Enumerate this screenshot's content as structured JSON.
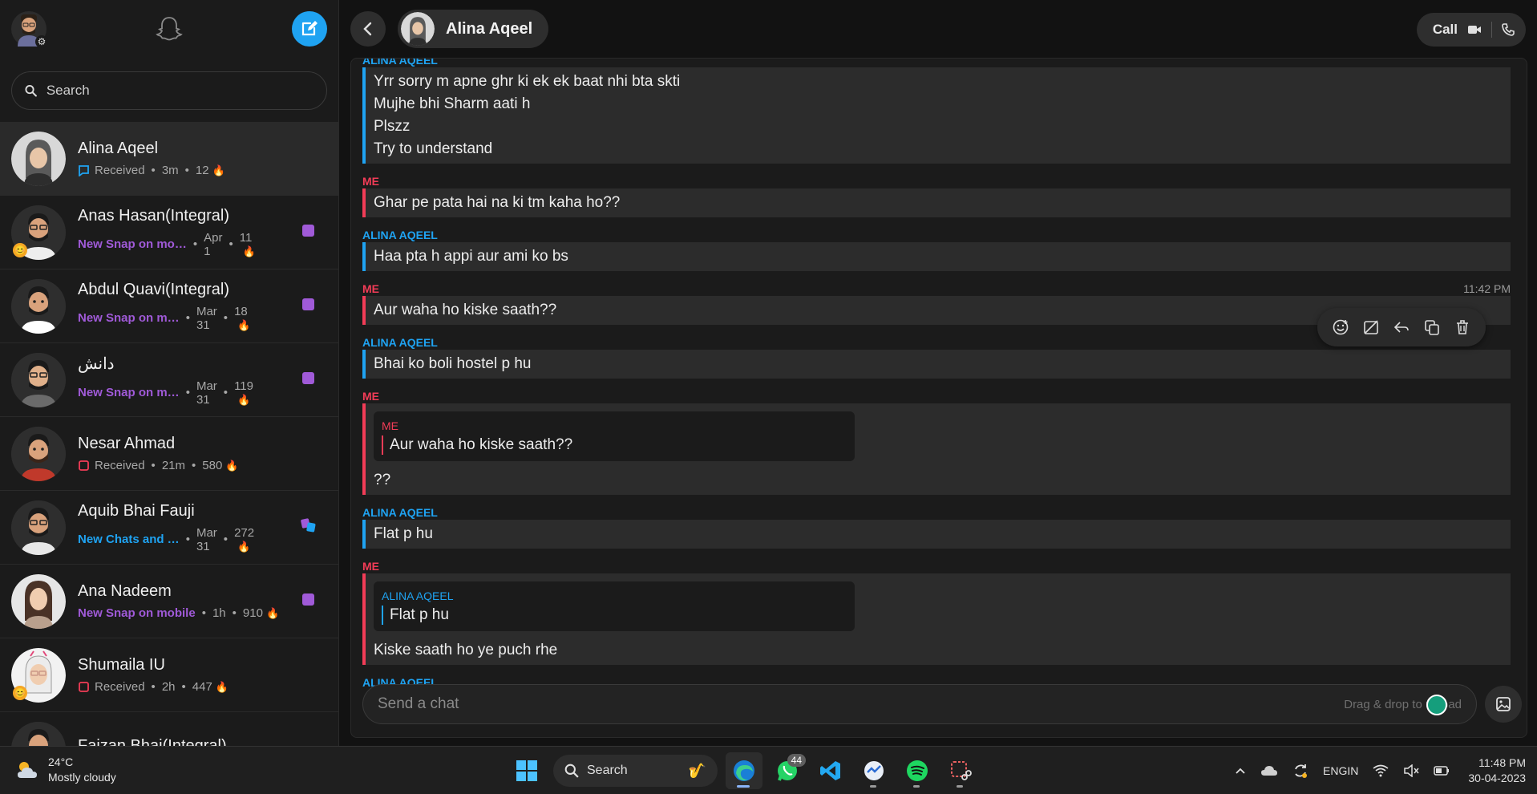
{
  "sidebar": {
    "search_placeholder": "Search",
    "chats": [
      {
        "name": "Alina Aqeel",
        "status_kind": "received-chat",
        "status": "Received",
        "time": "3m",
        "streak": "12",
        "active": true
      },
      {
        "name": "Anas Hasan(Integral)",
        "status_kind": "new-snap",
        "status": "New Snap on mo…",
        "time_a": "Apr",
        "time_b": "1",
        "streak": "11"
      },
      {
        "name": "Abdul Quavi(Integral)",
        "status_kind": "new-snap",
        "status": "New Snap on m…",
        "time_a": "Mar",
        "time_b": "31",
        "streak": "18"
      },
      {
        "name": "دانش",
        "status_kind": "new-snap",
        "status": "New Snap on m…",
        "time_a": "Mar",
        "time_b": "31",
        "streak": "119"
      },
      {
        "name": "Nesar Ahmad",
        "status_kind": "received-snap",
        "status": "Received",
        "time": "21m",
        "streak": "580"
      },
      {
        "name": "Aquib Bhai Fauji",
        "status_kind": "new-chats",
        "status": "New Chats and …",
        "time_a": "Mar",
        "time_b": "31",
        "streak": "272"
      },
      {
        "name": "Ana Nadeem",
        "status_kind": "new-snap",
        "status": "New Snap on mobile",
        "time": "1h",
        "streak": "910"
      },
      {
        "name": "Shumaila IU",
        "status_kind": "received-snap",
        "status": "Received",
        "time": "2h",
        "streak": "447"
      },
      {
        "name": "Faizan Bhai(Integral)"
      }
    ]
  },
  "header": {
    "contact_name": "Alina Aqeel",
    "call_label": "Call"
  },
  "messages": {
    "m1": {
      "sender": "ALINA AQEEL",
      "lines": [
        "Yrr sorry m apne ghr ki ek ek baat nhi bta skti",
        "Mujhe bhi Sharm aati h",
        "Plszz",
        "Try to understand"
      ]
    },
    "m2": {
      "sender": "ME",
      "lines": [
        "Ghar pe pata hai na ki tm kaha ho??"
      ]
    },
    "m3": {
      "sender": "ALINA AQEEL",
      "lines": [
        "Haa pta h appi aur ami ko bs"
      ]
    },
    "m4": {
      "sender": "ME",
      "timestamp": "11:42 PM",
      "lines": [
        "Aur waha ho kiske saath??"
      ]
    },
    "m5": {
      "sender": "ALINA AQEEL",
      "lines": [
        "Bhai ko boli hostel p hu"
      ]
    },
    "m6": {
      "sender": "ME",
      "quote_sender": "ME",
      "quote_text": "Aur waha ho kiske saath??",
      "lines": [
        "??"
      ]
    },
    "m7": {
      "sender": "ALINA AQEEL",
      "lines": [
        "Flat p hu"
      ]
    },
    "m8": {
      "sender": "ME",
      "quote_sender": "ALINA AQEEL",
      "quote_text": "Flat p hu",
      "lines": [
        "Kiske saath ho ye puch rhe"
      ]
    },
    "m9": {
      "sender": "ALINA AQEEL"
    }
  },
  "composer": {
    "placeholder": "Send a chat",
    "hint": "Drag & drop to upload"
  },
  "taskbar": {
    "temp": "24°C",
    "weather": "Mostly cloudy",
    "search": "Search",
    "whatsapp_badge": "44",
    "lang_top": "ENG",
    "lang_bottom": "IN",
    "time": "11:48 PM",
    "date": "30-04-2023"
  },
  "colors": {
    "accent_blue": "#1fa3f2",
    "me_red": "#f23c57",
    "snap_purple": "#a05ad8",
    "streak_orange": "#f29a1d"
  }
}
